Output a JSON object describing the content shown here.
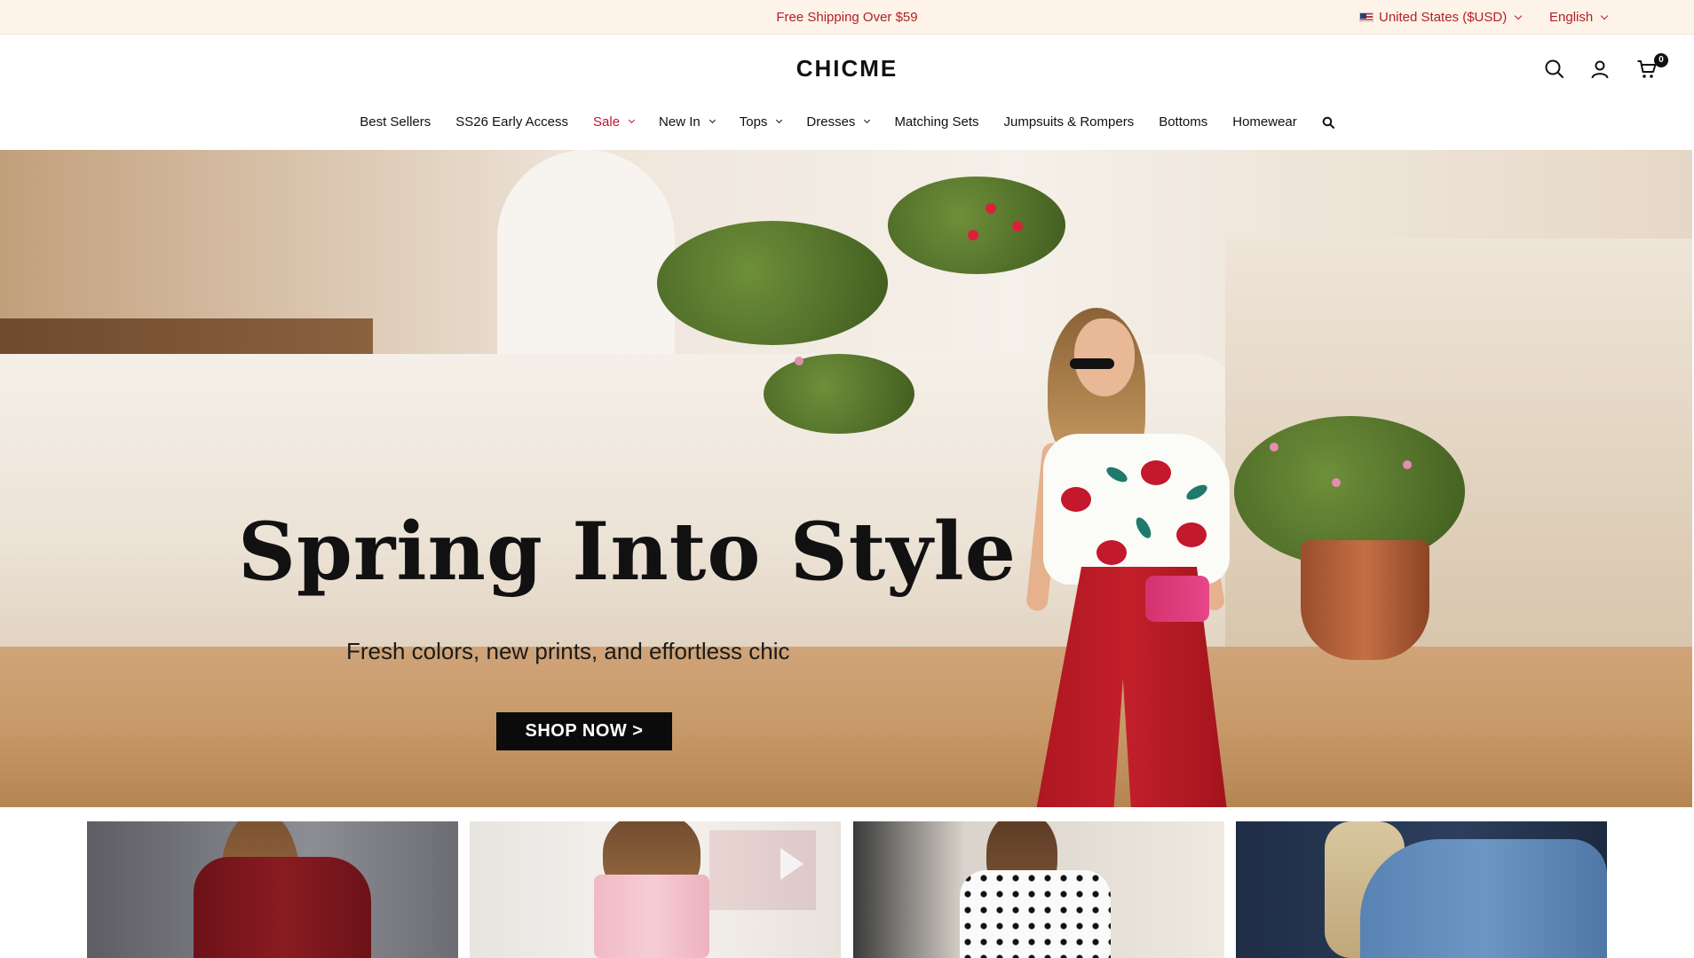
{
  "topbar": {
    "promo": "Free Shipping Over $59",
    "region": "United States ($USD)",
    "language": "English"
  },
  "header": {
    "logo": "CHICME",
    "cart_count": "0"
  },
  "nav": {
    "items": [
      {
        "label": "Best Sellers",
        "dropdown": false
      },
      {
        "label": "SS26 Early Access",
        "dropdown": false
      },
      {
        "label": "Sale",
        "dropdown": true,
        "highlight": "#c8102e"
      },
      {
        "label": "New In",
        "dropdown": true
      },
      {
        "label": "Tops",
        "dropdown": true
      },
      {
        "label": "Dresses",
        "dropdown": true
      },
      {
        "label": "Matching Sets",
        "dropdown": false
      },
      {
        "label": "Jumpsuits & Rompers",
        "dropdown": false
      },
      {
        "label": "Bottoms",
        "dropdown": false
      },
      {
        "label": "Homewear",
        "dropdown": false
      }
    ]
  },
  "hero": {
    "title": "Spring Into Style",
    "subtitle": "Fresh colors, new prints, and effortless chic",
    "cta": "SHOP NOW >"
  },
  "colors": {
    "accent_red": "#b32025",
    "topbar_bg": "#fdf3e8",
    "button_bg": "#0b0b0b"
  }
}
